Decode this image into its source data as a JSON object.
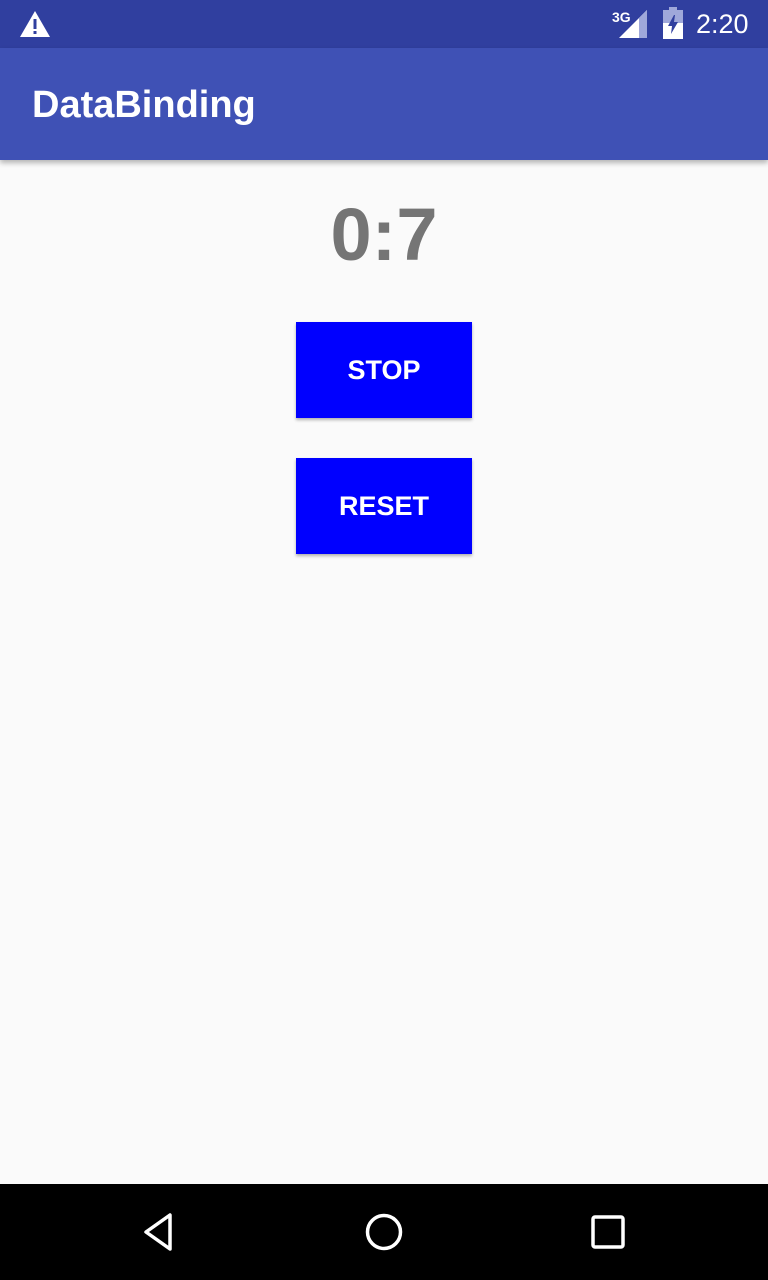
{
  "status_bar": {
    "network_type": "3G",
    "clock": "2:20",
    "icons": [
      "warning-icon",
      "signal-icon",
      "battery-icon"
    ]
  },
  "app_bar": {
    "title": "DataBinding"
  },
  "main": {
    "timer_text": "0:7",
    "stop_label": "STOP",
    "reset_label": "RESET"
  },
  "nav_bar": {
    "icons": [
      "back-icon",
      "home-icon",
      "recent-apps-icon"
    ]
  },
  "colors": {
    "status_bar": "#303f9f",
    "app_bar": "#3f51b5",
    "button": "#0000ff",
    "timer_text": "#757575",
    "background": "#fafafa"
  }
}
